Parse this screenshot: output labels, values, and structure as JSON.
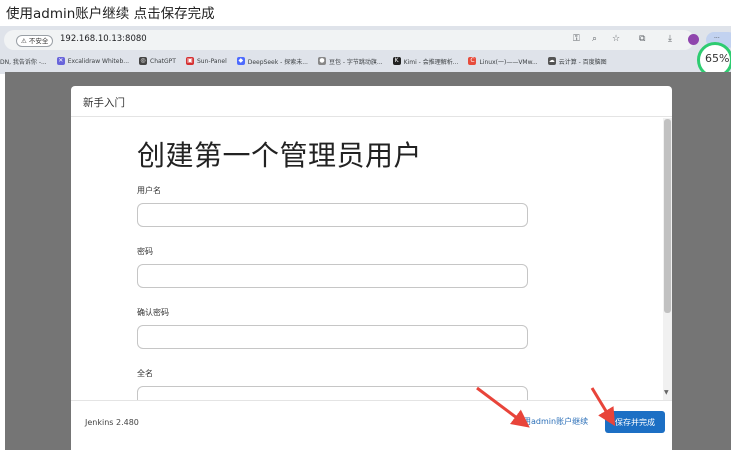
{
  "caption": "使用admin账户继续 点击保存完成",
  "browser": {
    "security_label": "不安全",
    "url": "192.168.10.13:8080",
    "bookmarks": [
      {
        "label": "DN, 我告诉你 -...",
        "color": ""
      },
      {
        "label": "Excalidraw Whiteb...",
        "color": "#6965db"
      },
      {
        "label": "ChatGPT",
        "color": "#444444"
      },
      {
        "label": "Sun-Panel",
        "color": "#d63031"
      },
      {
        "label": "DeepSeek - 探索未...",
        "color": "#4d6bfe"
      },
      {
        "label": "豆包 - 字节跳动旗...",
        "color": "#888888"
      },
      {
        "label": "Kimi - 会推理解析...",
        "color": "#222222"
      },
      {
        "label": "Linux(一)——VMw...",
        "color": "#e74c3c"
      },
      {
        "label": "云计算 - 百度脑图",
        "color": "#555555"
      }
    ],
    "progress_text": "65"
  },
  "dialog": {
    "title": "新手入门",
    "heading": "创建第一个管理员用户",
    "fields": [
      {
        "label": "用户名",
        "value": ""
      },
      {
        "label": "密码",
        "value": ""
      },
      {
        "label": "确认密码",
        "value": ""
      },
      {
        "label": "全名",
        "value": ""
      }
    ],
    "version": "Jenkins 2.480",
    "continue_admin_label": "使用admin账户继续",
    "save_label": "保存并完成"
  },
  "colors": {
    "primary_button": "#1c6fc4",
    "link": "#2b6fb8",
    "annotation_arrow": "#e8443a",
    "backdrop": "#757575"
  }
}
